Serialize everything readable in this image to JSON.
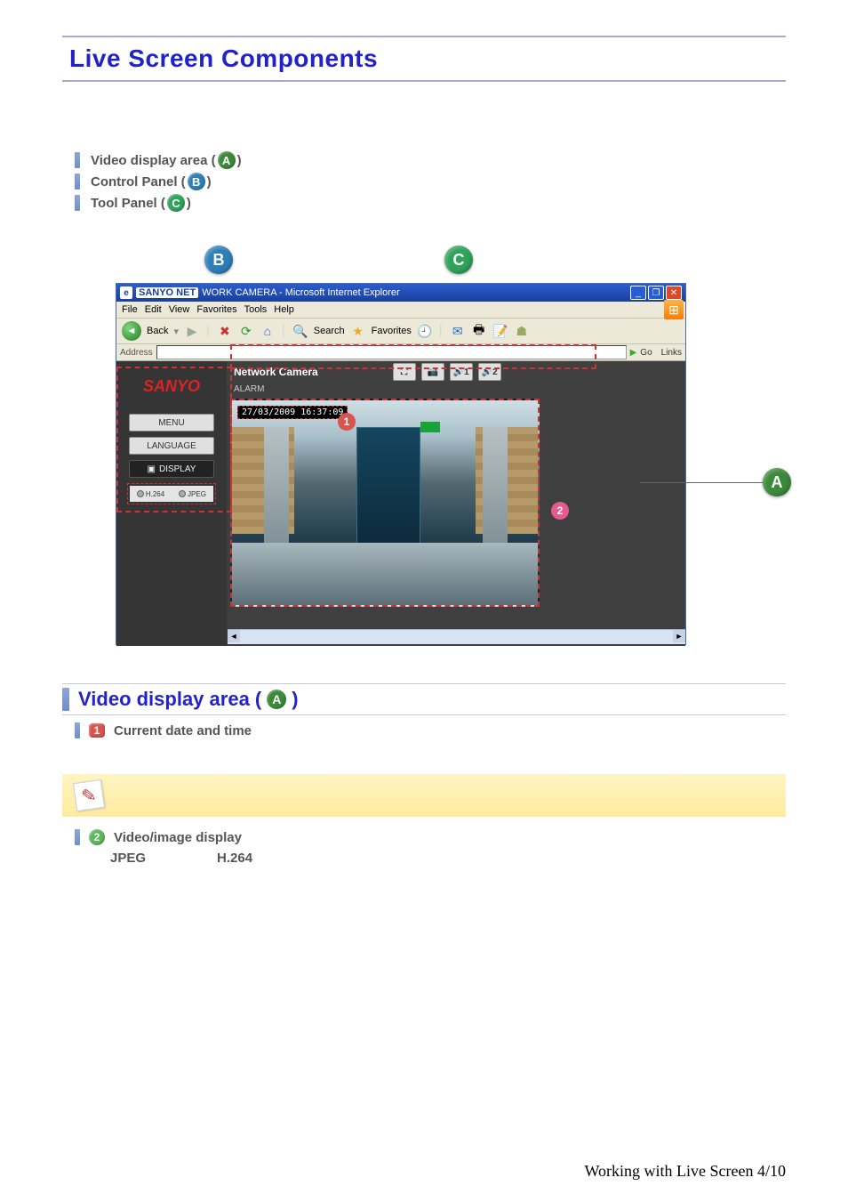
{
  "page_title": "Live Screen Components",
  "legend": {
    "video_display": {
      "prefix": "Video display area (",
      "suffix": " )",
      "letter": "A"
    },
    "control_panel": {
      "prefix": "Control Panel (",
      "suffix": " )",
      "letter": "B"
    },
    "tool_panel": {
      "prefix": "Tool Panel (",
      "suffix": " )",
      "letter": "C"
    }
  },
  "browser": {
    "title_prefix": "SANYO NET",
    "title_rest": "WORK CAMERA - Microsoft Internet Explorer",
    "menus": [
      "File",
      "Edit",
      "View",
      "Favorites",
      "Tools",
      "Help"
    ],
    "back_label": "Back",
    "toolbar": {
      "search": "Search",
      "favorites": "Favorites"
    },
    "address_label": "Address",
    "go_label": "Go",
    "links_label": "Links"
  },
  "sidebar": {
    "logo": "SANYO",
    "menu_btn": "MENU",
    "language_btn": "LANGUAGE",
    "display_btn": "DISPLAY",
    "tabs": {
      "h264": "H.264",
      "jpeg": "JPEG"
    }
  },
  "toolbar": {
    "title": "Network Camera",
    "alarm_label": "ALARM",
    "btn_capture": "⛶",
    "btn_snapshot": "📷",
    "btn_audio1": "🔊1",
    "btn_audio2": "🔊2"
  },
  "overlay": {
    "timestamp": "27/03/2009 16:37:09"
  },
  "callouts": {
    "A": "A",
    "B": "B",
    "C": "C",
    "n1": "1",
    "n2": "2"
  },
  "sub": {
    "heading_prefix": "Video display area (",
    "heading_letter": "A",
    "heading_suffix": " )",
    "item1": {
      "num": "1",
      "text": "Current date and time"
    },
    "item2": {
      "num": "2",
      "text": "Video/image display",
      "col1": "JPEG",
      "col2": "H.264"
    }
  },
  "footer": "Working with Live Screen 4/10"
}
